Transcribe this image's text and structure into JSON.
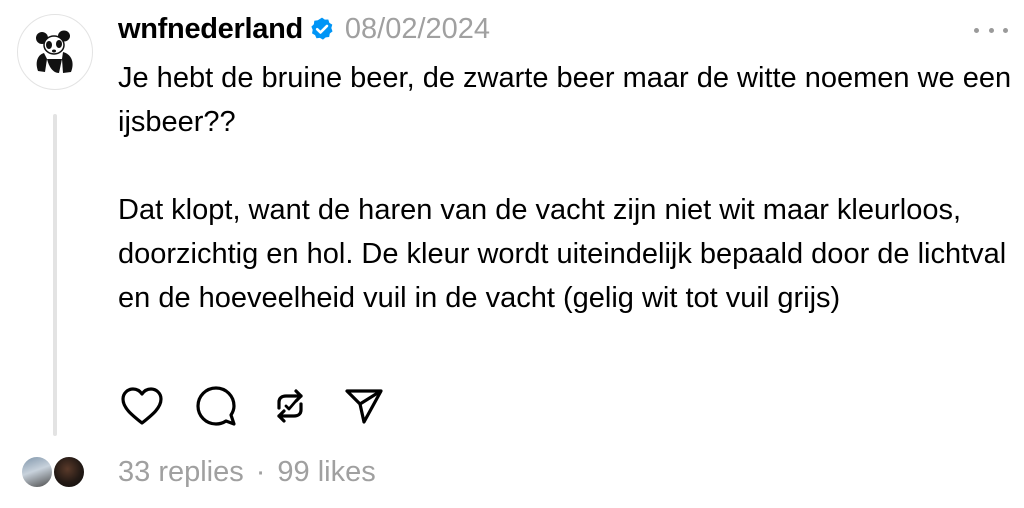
{
  "post": {
    "username": "wnfnederland",
    "date": "08/02/2024",
    "paragraphs": [
      "Je hebt de bruine beer, de zwarte beer maar de witte noemen we een ijsbeer??",
      "Dat klopt, want de haren van de vacht zijn niet wit maar kleurloos, doorzichtig en hol. De kleur wordt uiteindelijk bepaald door de lichtval en de hoeveelheid vuil in de vacht (gelig wit tot vuil grijs)"
    ],
    "replies": "33 replies",
    "separator": "·",
    "likes": "99 likes"
  },
  "icons": {
    "avatar": "wwf-panda-logo",
    "verified": "verified-badge-icon",
    "more": "more-options-icon",
    "like": "heart-icon",
    "reply": "comment-icon",
    "repost": "repost-icon",
    "share": "send-icon"
  },
  "colors": {
    "verified": "#0095f6",
    "muted": "#a0a0a0",
    "thread_line": "#e3e3e3"
  }
}
